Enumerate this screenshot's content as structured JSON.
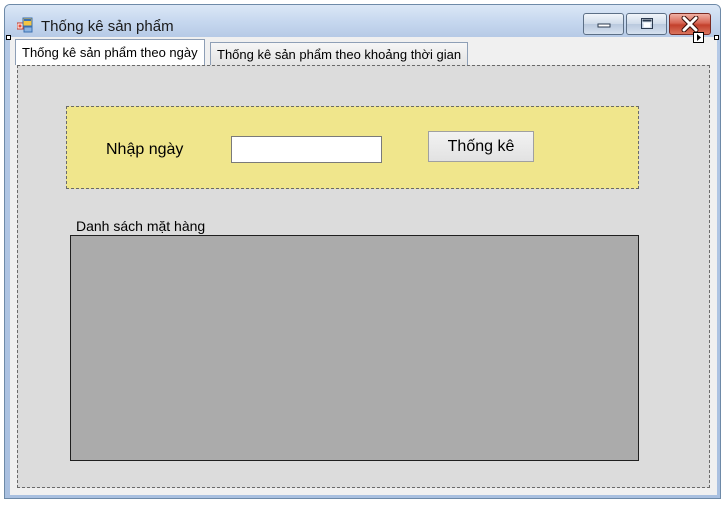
{
  "window": {
    "title": "Thống kê sản phẩm"
  },
  "tabs": [
    {
      "label": "Thống kê sản phẩm theo ngày",
      "active": true
    },
    {
      "label": "Thống kê sản phẩm theo khoảng thời gian",
      "active": false
    }
  ],
  "form": {
    "date_label": "Nhập ngày",
    "date_value": "",
    "stat_button_label": "Thống kê",
    "list_label": "Danh sách mặt hàng"
  },
  "icons": {
    "app": "app-form-icon",
    "minimize": "minimize-icon",
    "maximize": "maximize-icon",
    "close": "close-icon"
  },
  "colors": {
    "panel_background": "#f0e68c",
    "tabpage_background": "#dcdcdc",
    "grid_background": "#ababab",
    "close_button": "#c3402c"
  }
}
